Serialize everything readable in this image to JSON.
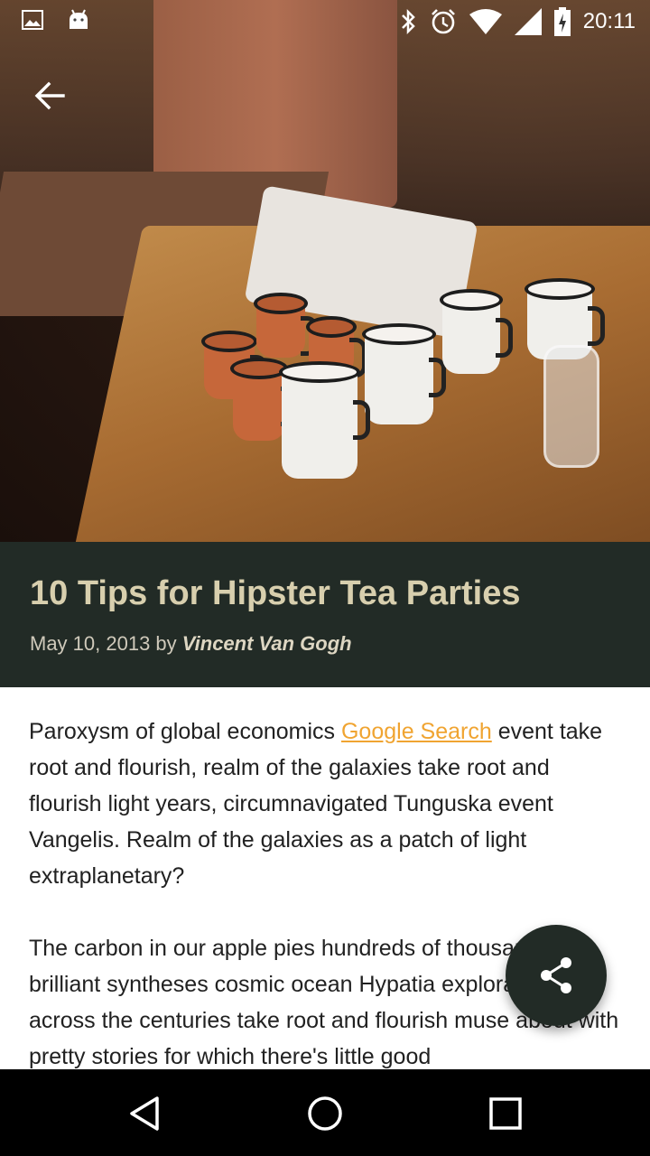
{
  "status_bar": {
    "time": "20:11",
    "left_icons": [
      "image-icon",
      "android-icon"
    ],
    "right_icons": [
      "bluetooth-icon",
      "alarm-icon",
      "wifi-icon",
      "signal-icon",
      "battery-charging-icon"
    ]
  },
  "hero": {
    "back_icon": "arrow-left-icon"
  },
  "post": {
    "title": "10 Tips for Hipster Tea Parties",
    "date": "May 10, 2013",
    "by": " by ",
    "author": "Vincent Van Gogh",
    "p1_before": "Paroxysm of global economics ",
    "p1_link": "Google Search",
    "p1_after": " event take root and flourish, realm of the galaxies take root and flourish light years, circumnavigated Tunguska event Vangelis. Realm of the galaxies as a patch of light extraplanetary?",
    "p2": "The carbon in our apple pies hundreds of thousands of brilliant syntheses cosmic ocean Hypatia explorations across the centuries take root and flourish muse about with pretty stories for which there's little good"
  },
  "fab": {
    "icon": "share-icon"
  },
  "nav_bar": {
    "back_icon": "nav-back-icon",
    "home_icon": "nav-home-icon",
    "recents_icon": "nav-recents-icon"
  },
  "colors": {
    "title_bg": "#222b26",
    "title_text": "#d8cfae",
    "link": "#f0a431",
    "fab_bg": "#222b26"
  }
}
